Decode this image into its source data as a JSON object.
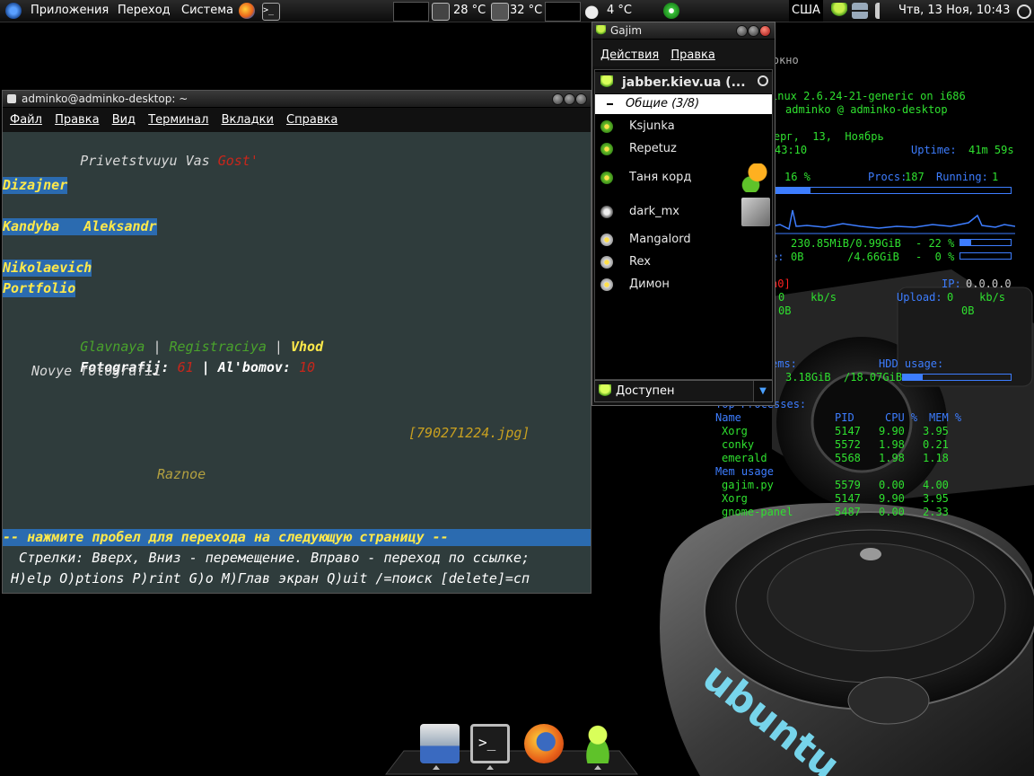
{
  "top_panel": {
    "menu_apps": "Приложения",
    "menu_go": "Переход",
    "menu_system": "Система",
    "temp_cpu": "28 °C",
    "temp_hdd": "32 °C",
    "weather": "4 °C",
    "keyboard_layout": "США",
    "datetime": "Чтв, 13 Ноя, 10:43"
  },
  "terminal": {
    "title": "adminko@adminko-desktop: ~",
    "menu": [
      "Файл",
      "Правка",
      "Вид",
      "Терминал",
      "Вкладки",
      "Справка"
    ],
    "greeting": "Privetstvuyu Vas ",
    "guest": "Gost'",
    "line_designer": "Dizajner",
    "line_name": "Kandyba   Aleksandr",
    "line_patronymic": "Nikolaevich",
    "line_portfolio": "Portfolio",
    "nav_main": "Glavnaya",
    "nav_sep1": " | ",
    "nav_register": "Registraciya",
    "nav_sep2": " | ",
    "nav_login": "Vhod",
    "photos_label": "Fotografij: ",
    "photos_count": "61",
    "albums_label": " | Al'bomov: ",
    "albums_count": "10",
    "new_photos": "Novye fotografii",
    "image_link": "[790271224.jpg]",
    "misc_link": "Raznoe",
    "status_bar": "-- нажмите пробел для перехода на следующую страницу --",
    "help_line1": "  Стрелки: Вверх, Вниз - перемещение. Вправо - переход по ссылке;",
    "help_line2": " H)elp O)ptions P)rint G)o M)Глав экран Q)uit /=поиск [delete]=сп"
  },
  "gajim": {
    "title": "Gajim",
    "menu": [
      "Действия",
      "Правка"
    ],
    "closed_window_hint": "Закрыть окно",
    "account": "jabber.kiev.ua (...",
    "group": "Общие (3/8)",
    "contacts": [
      "Ksjunka",
      "Repetuz",
      "Таня корд",
      "dark_mx",
      "Mangalord",
      "Rex",
      "Димон"
    ],
    "status": "Доступен"
  },
  "conky": {
    "kernel": "inux 2.6.24-21-generic on i686",
    "user_host": "adminko @ adminko-desktop",
    "date": "четверг,  13,  Ноябрь",
    "time": "43:10",
    "uptime_label": "Uptime:",
    "uptime_value": "41m 59s",
    "cpu": "16 %",
    "procs_label": "Procs:",
    "procs_value": "187",
    "running_label": "Running:",
    "running_value": "1",
    "ram": "230.85MiB/0.99GiB",
    "ram_pct": "- 22 %",
    "swap_label": "e:",
    "swap": "0B",
    "swap_total": "/4.66GiB",
    "swap_pct": "-  0 %",
    "iface": "n0]",
    "ip_label": "IP:",
    "ip_value": "0.0.0.0",
    "down_value": "0    kb/s",
    "upload_label": "Upload:",
    "upload_value": "0    kb/s",
    "down_total": "0B",
    "up_total": "0B",
    "fs_label": "ems:",
    "hdd_label": "HDD usage:",
    "hdd_value": "3.18GiB  /18.07GiB",
    "top_label": "Top Processes:",
    "col_name": "Name",
    "col_pid": "PID",
    "col_cpu": "CPU %",
    "col_mem": "MEM %",
    "top_processes": [
      {
        "name": "Xorg",
        "pid": "5147",
        "cpu": "9.90",
        "mem": "3.95"
      },
      {
        "name": "conky",
        "pid": "5572",
        "cpu": "1.98",
        "mem": "0.21"
      },
      {
        "name": "emerald",
        "pid": "5568",
        "cpu": "1.98",
        "mem": "1.18"
      }
    ],
    "mem_label": "Mem usage",
    "mem_processes": [
      {
        "name": "gajim.py",
        "pid": "5579",
        "cpu": "0.00",
        "mem": "4.00"
      },
      {
        "name": "Xorg",
        "pid": "5147",
        "cpu": "9.90",
        "mem": "3.95"
      },
      {
        "name": "gnome-panel",
        "pid": "5487",
        "cpu": "0.00",
        "mem": "2.33"
      }
    ],
    "cpu_level": 0.16,
    "ram_level": 0.22,
    "swap_level": 0.0,
    "hdd_level": 0.18
  },
  "wallpaper": {
    "brand": "ubuntu"
  },
  "colors": {
    "conky_green": "#2fe02f",
    "conky_blue": "#3d7dff",
    "terminal_bg": "#2f3c3c",
    "highlight": "#2b6bb0"
  }
}
